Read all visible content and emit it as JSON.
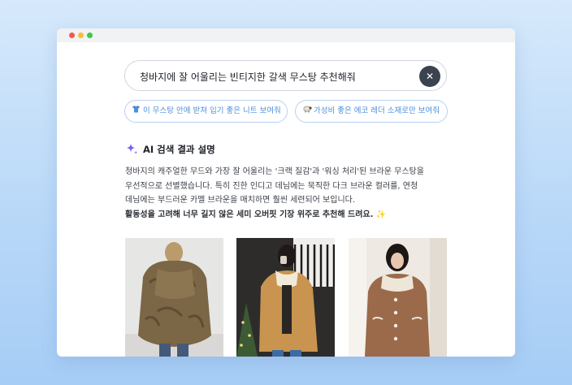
{
  "search": {
    "query": "청바지에 잘 어울리는 빈티지한 갈색 무스탕 추천해줘",
    "clear_icon": "close-icon",
    "clear_glyph": "✕"
  },
  "suggestions": [
    {
      "label": "이 무스탕 안에 받쳐 입기 좋은 니트 보여줘",
      "icon": "shirt-icon"
    },
    {
      "label": "가성비 좋은 에코 레더 소재로만 보여줘",
      "icon": "sheep-icon"
    }
  ],
  "ai_result": {
    "title": "AI 검색 결과 설명",
    "icon": "sparkle-icon",
    "lines": [
      "청바지의 캐주얼한 무드와 가장 잘 어울리는 '크랙 질감'과 '워싱 처리'된 브라운 무스탕을",
      "우선적으로 선별했습니다. 특히 진한 인디고 데님에는 묵직한 다크 브라운 컬러를, 연청",
      "데님에는 부드러운 카멜 브라운을 매치하면 훨씬 세련되어 보입니다."
    ],
    "emphasis": "활동성을 고려해 너무 길지 않은 세미 오버핏 기장 위주로 추천해 드려요.",
    "emphasis_emoji": "✨"
  },
  "colors": {
    "accent": "#4d8fd8",
    "sparkle": "#7b5cf0",
    "clear_button": "#3b4250"
  }
}
